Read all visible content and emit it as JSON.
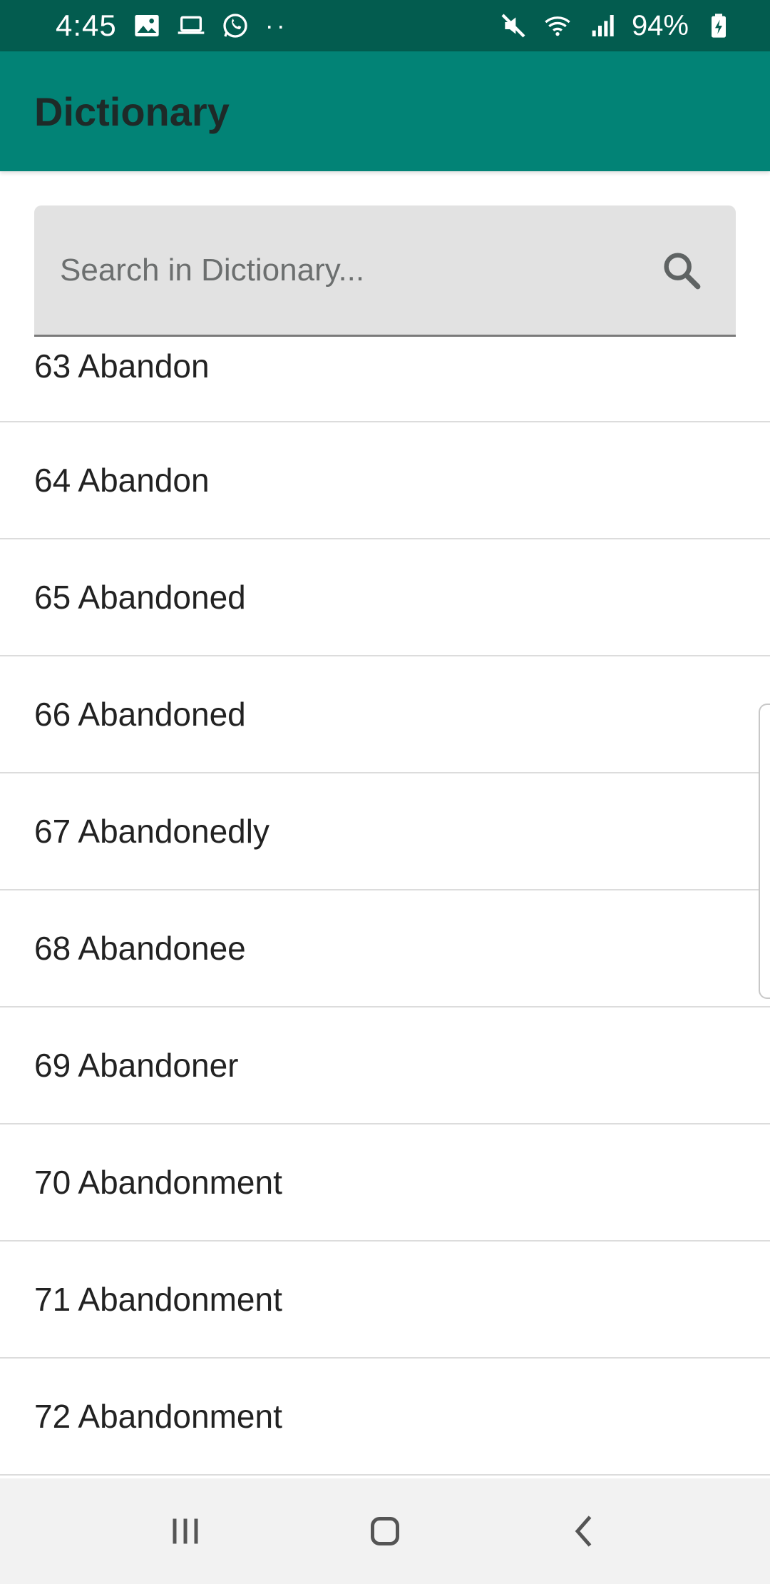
{
  "status_bar": {
    "time": "4:45",
    "battery": "94%",
    "left_icons": [
      "gallery-icon",
      "laptop-icon",
      "whatsapp-icon",
      "more-dots-icon"
    ],
    "right_icons": [
      "mute-icon",
      "wifi-icon",
      "signal-icon",
      "battery-charging-icon"
    ]
  },
  "app_bar": {
    "title": "Dictionary",
    "color": "#028376"
  },
  "search": {
    "placeholder": "Search in Dictionary...",
    "value": ""
  },
  "list": {
    "items": [
      "63 Abandon",
      "64 Abandon",
      "65 Abandoned",
      "66 Abandoned",
      "67 Abandonedly",
      "68 Abandonee",
      "69 Abandoner",
      "70 Abandonment",
      "71 Abandonment",
      "72 Abandonment"
    ]
  },
  "nav_bar": {
    "buttons": [
      "recents-icon",
      "home-icon",
      "back-icon"
    ]
  }
}
